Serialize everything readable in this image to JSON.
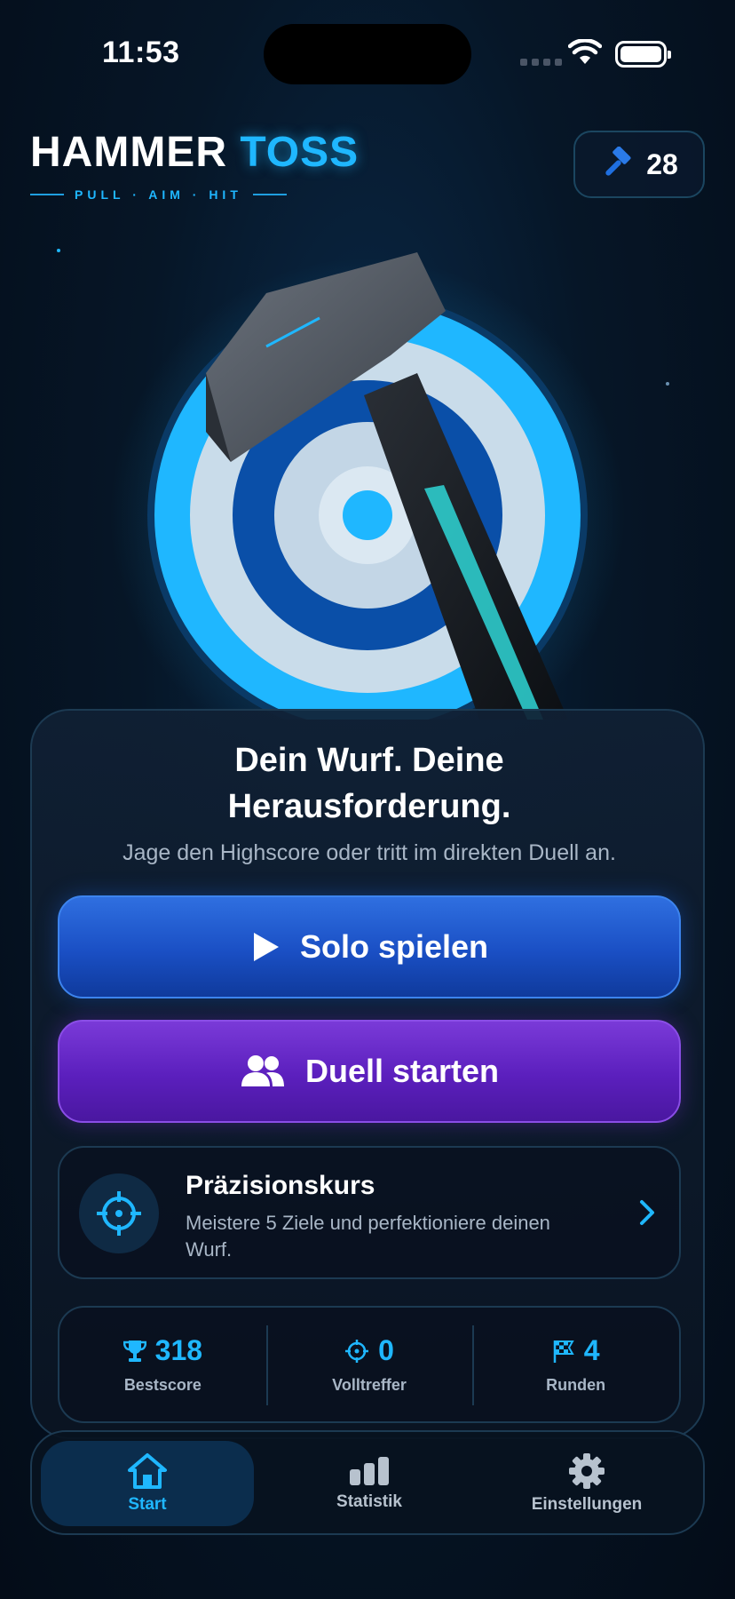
{
  "status_bar": {
    "time": "11:53"
  },
  "header": {
    "title_part1": "HAMMER",
    "title_part2": "TOSS",
    "tagline": "PULL · AIM · HIT",
    "hammer_count": "28"
  },
  "main": {
    "headline_line1": "Dein Wurf. Deine",
    "headline_line2": "Herausforderung.",
    "subline": "Jage den Highscore oder tritt im direkten Duell an.",
    "solo_button": "Solo spielen",
    "duel_button": "Duell starten",
    "course": {
      "title": "Präzisionskurs",
      "description": "Meistere 5 Ziele und perfektioniere deinen Wurf."
    },
    "stats": [
      {
        "icon": "trophy-icon",
        "value": "318",
        "label": "Bestscore"
      },
      {
        "icon": "crosshair-icon",
        "value": "0",
        "label": "Volltreffer"
      },
      {
        "icon": "checkered-flag-icon",
        "value": "4",
        "label": "Runden"
      }
    ]
  },
  "tabbar": {
    "items": [
      {
        "label": "Start",
        "icon": "home-icon",
        "active": true
      },
      {
        "label": "Statistik",
        "icon": "bar-chart-icon",
        "active": false
      },
      {
        "label": "Einstellungen",
        "icon": "gear-icon",
        "active": false
      }
    ]
  },
  "colors": {
    "accent": "#1fb7ff",
    "solo_button": "#1a4fc4",
    "duel_button": "#5b1fbd",
    "background": "#061627"
  }
}
